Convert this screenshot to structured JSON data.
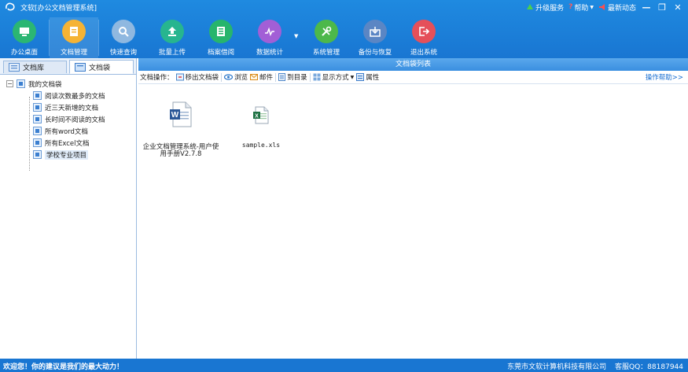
{
  "window": {
    "title": "文软[办公文档管理系统]",
    "upgrade": "升级服务",
    "help": "帮助",
    "news": "最新动态"
  },
  "toolbar": {
    "items": [
      {
        "label": "办公桌面",
        "icon": "desktop-icon",
        "color": "#2bb673"
      },
      {
        "label": "文档管理",
        "icon": "document-manage-icon",
        "color": "#f5b335"
      },
      {
        "label": "快速查询",
        "icon": "search-icon",
        "color": "#8fb8e0"
      },
      {
        "label": "批量上传",
        "icon": "upload-icon",
        "color": "#27b58f"
      },
      {
        "label": "档案借阅",
        "icon": "archive-icon",
        "color": "#27b56c"
      },
      {
        "label": "数据统计",
        "icon": "chart-icon",
        "color": "#a25fd6"
      },
      {
        "label": "系统管理",
        "icon": "settings-icon",
        "color": "#4db84a"
      },
      {
        "label": "备份与恢复",
        "icon": "backup-icon",
        "color": "#5b86c4"
      },
      {
        "label": "退出系统",
        "icon": "exit-icon",
        "color": "#e5505a"
      }
    ]
  },
  "left": {
    "tab1": "文档库",
    "tab2": "文档袋",
    "root": "我的文档袋",
    "items": [
      "阅读次数最多的文档",
      "近三天新增的文档",
      "长时间不阅读的文档",
      "所有word文档",
      "所有Excel文档",
      "学校专业项目"
    ]
  },
  "main": {
    "header": "文档袋列表",
    "ops_label": "文档操作：",
    "ops": [
      "移出文档袋",
      "浏览",
      "邮件",
      "到目录",
      "显示方式",
      "属性"
    ],
    "help": "操作帮助>>",
    "files": [
      {
        "name": "企业文档管理系统-用户使用手册V2.7.8",
        "type": "word"
      },
      {
        "name": "sample.xls",
        "type": "excel"
      }
    ]
  },
  "status": {
    "left": "欢迎您！你的建议是我们的最大动力！",
    "company": "东莞市文软计算机科技有限公司",
    "qq": "客服QQ：88187944"
  }
}
